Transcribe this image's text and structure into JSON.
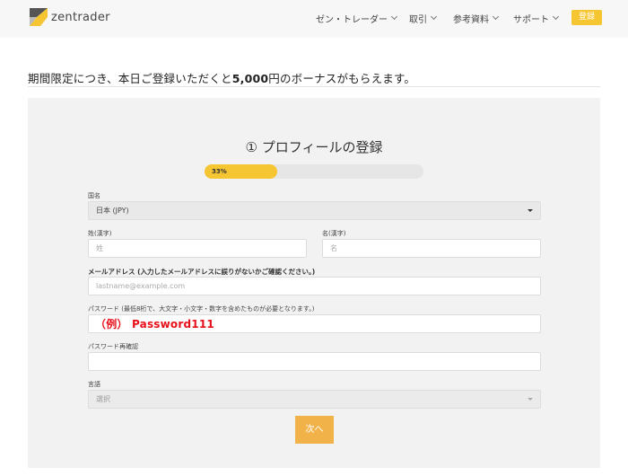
{
  "header": {
    "logo_text": "zentrader",
    "nav": [
      {
        "label": "ゼン・トレーダー"
      },
      {
        "label": "取引"
      },
      {
        "label": "参考資料"
      },
      {
        "label": "サポート"
      }
    ],
    "register_label": "登録"
  },
  "promo": {
    "prefix": "期間限定につき、本日ご登録いただくと",
    "amount": "5,000",
    "suffix": "円のボーナスがもらえます。"
  },
  "form": {
    "title": "① プロフィールの登録",
    "progress": {
      "percent": 33,
      "label": "33%"
    },
    "country": {
      "label": "国名",
      "value": "日本 (JPY)"
    },
    "last_name": {
      "label": "姓(漢字)",
      "placeholder": "姓"
    },
    "first_name": {
      "label": "名(漢字)",
      "placeholder": "名"
    },
    "email": {
      "label": "メールアドレス (入力したメールアドレスに誤りがないかご確認ください。)",
      "placeholder": "lastname@example.com"
    },
    "password": {
      "label": "パスワード (最低8桁で、大文字・小文字・数字を含めたものが必要となります。)",
      "example": "（例） Password111"
    },
    "password_confirm": {
      "label": "パスワード再確認"
    },
    "language": {
      "label": "言語",
      "value": "選択"
    },
    "next_label": "次へ"
  },
  "colors": {
    "accent": "#f6c532",
    "next_button": "#f1b349",
    "example_text": "#e8101a"
  }
}
